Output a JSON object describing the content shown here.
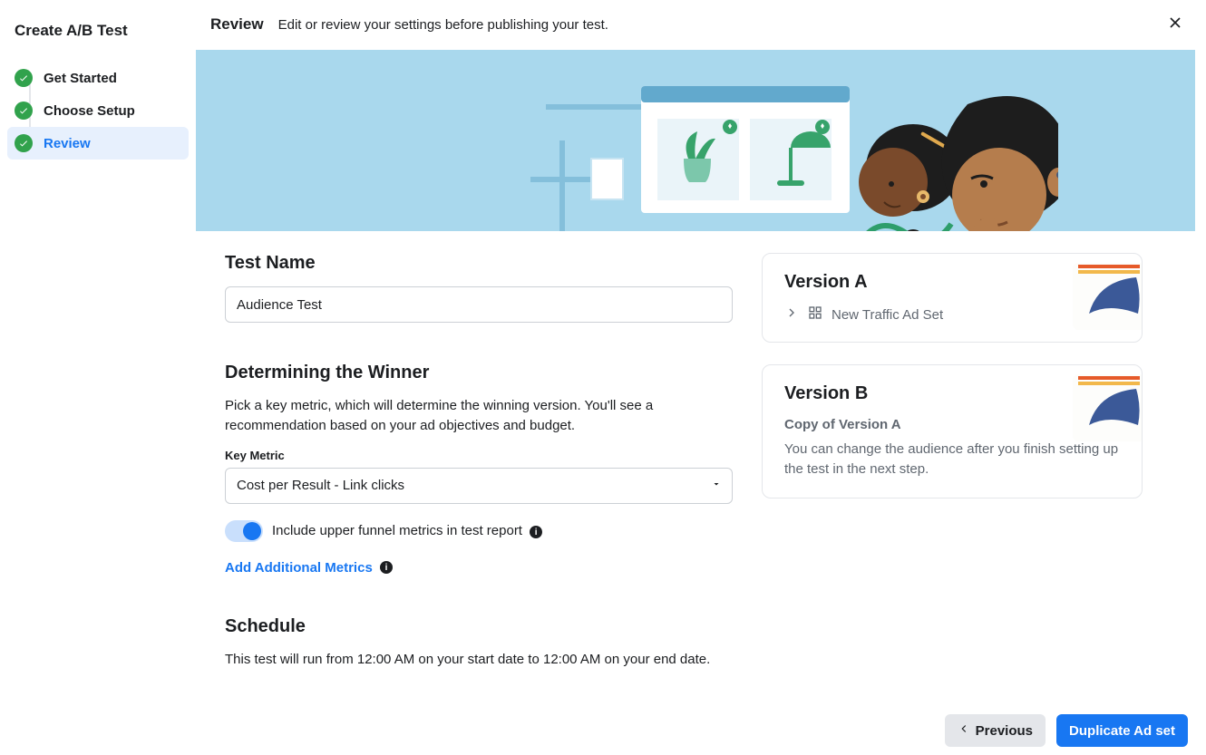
{
  "sidebar": {
    "title": "Create A/B Test",
    "steps": [
      {
        "label": "Get Started"
      },
      {
        "label": "Choose Setup"
      },
      {
        "label": "Review"
      }
    ]
  },
  "header": {
    "title": "Review",
    "subtitle": "Edit or review your settings before publishing your test."
  },
  "testName": {
    "heading": "Test Name",
    "value": "Audience Test"
  },
  "winner": {
    "heading": "Determining the Winner",
    "description": "Pick a key metric, which will determine the winning version. You'll see a recommendation based on your ad objectives and budget.",
    "fieldLabel": "Key Metric",
    "selected": "Cost per Result - Link clicks",
    "toggleLabel": "Include upper funnel metrics in test report",
    "addLink": "Add Additional Metrics"
  },
  "schedule": {
    "heading": "Schedule",
    "description": "This test will run from 12:00 AM on your start date to 12:00 AM on your end date."
  },
  "versionA": {
    "title": "Version A",
    "adset": "New Traffic Ad Set"
  },
  "versionB": {
    "title": "Version B",
    "subtitle": "Copy of Version A",
    "description": "You can change the audience after you finish setting up the test in the next step."
  },
  "footer": {
    "previous": "Previous",
    "primary": "Duplicate Ad set"
  }
}
